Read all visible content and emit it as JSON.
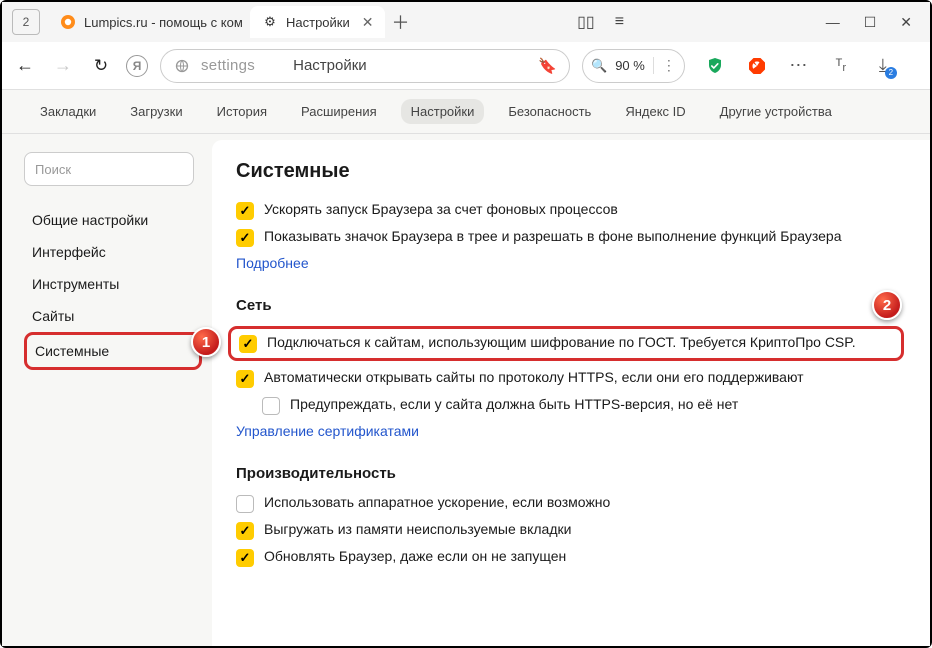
{
  "titlebar": {
    "tab_count": "2",
    "tabs": [
      {
        "favicon": "●",
        "favicon_color": "#ff8c1a",
        "label": "Lumpics.ru - помощь с ком",
        "active": false
      },
      {
        "favicon": "⚙",
        "favicon_color": "#333333",
        "label": "Настройки",
        "active": true
      }
    ]
  },
  "addrbar": {
    "url_text": "settings",
    "url_title": "Настройки",
    "zoom": "90 %",
    "dl_badge": "2"
  },
  "subnav": {
    "items": [
      "Закладки",
      "Загрузки",
      "История",
      "Расширения",
      "Настройки",
      "Безопасность",
      "Яндекс ID",
      "Другие устройства"
    ],
    "active_index": 4
  },
  "sidebar": {
    "search_placeholder": "Поиск",
    "items": [
      "Общие настройки",
      "Интерфейс",
      "Инструменты",
      "Сайты",
      "Системные"
    ],
    "selected_index": 4
  },
  "content": {
    "section_title": "Системные",
    "top_opts": [
      {
        "checked": true,
        "label": "Ускорять запуск Браузера за счет фоновых процессов"
      },
      {
        "checked": true,
        "label": "Показывать значок Браузера в трее и разрешать в фоне выполнение функций Браузера"
      }
    ],
    "top_link": "Подробнее",
    "net_head": "Сеть",
    "net_opts": [
      {
        "checked": true,
        "label": "Подключаться к сайтам, использующим шифрование по ГОСТ. Требуется КриптоПро CSP.",
        "highlight": true
      },
      {
        "checked": true,
        "label": "Автоматически открывать сайты по протоколу HTTPS, если они его поддерживают"
      },
      {
        "checked": false,
        "label": "Предупреждать, если у сайта должна быть HTTPS-версия, но её нет",
        "indent": true
      }
    ],
    "net_link": "Управление сертификатами",
    "perf_head": "Производительность",
    "perf_opts": [
      {
        "checked": false,
        "label": "Использовать аппаратное ускорение, если возможно"
      },
      {
        "checked": true,
        "label": "Выгружать из памяти неиспользуемые вкладки"
      },
      {
        "checked": true,
        "label": "Обновлять Браузер, даже если он не запущен"
      }
    ]
  },
  "callouts": {
    "one": "1",
    "two": "2"
  }
}
